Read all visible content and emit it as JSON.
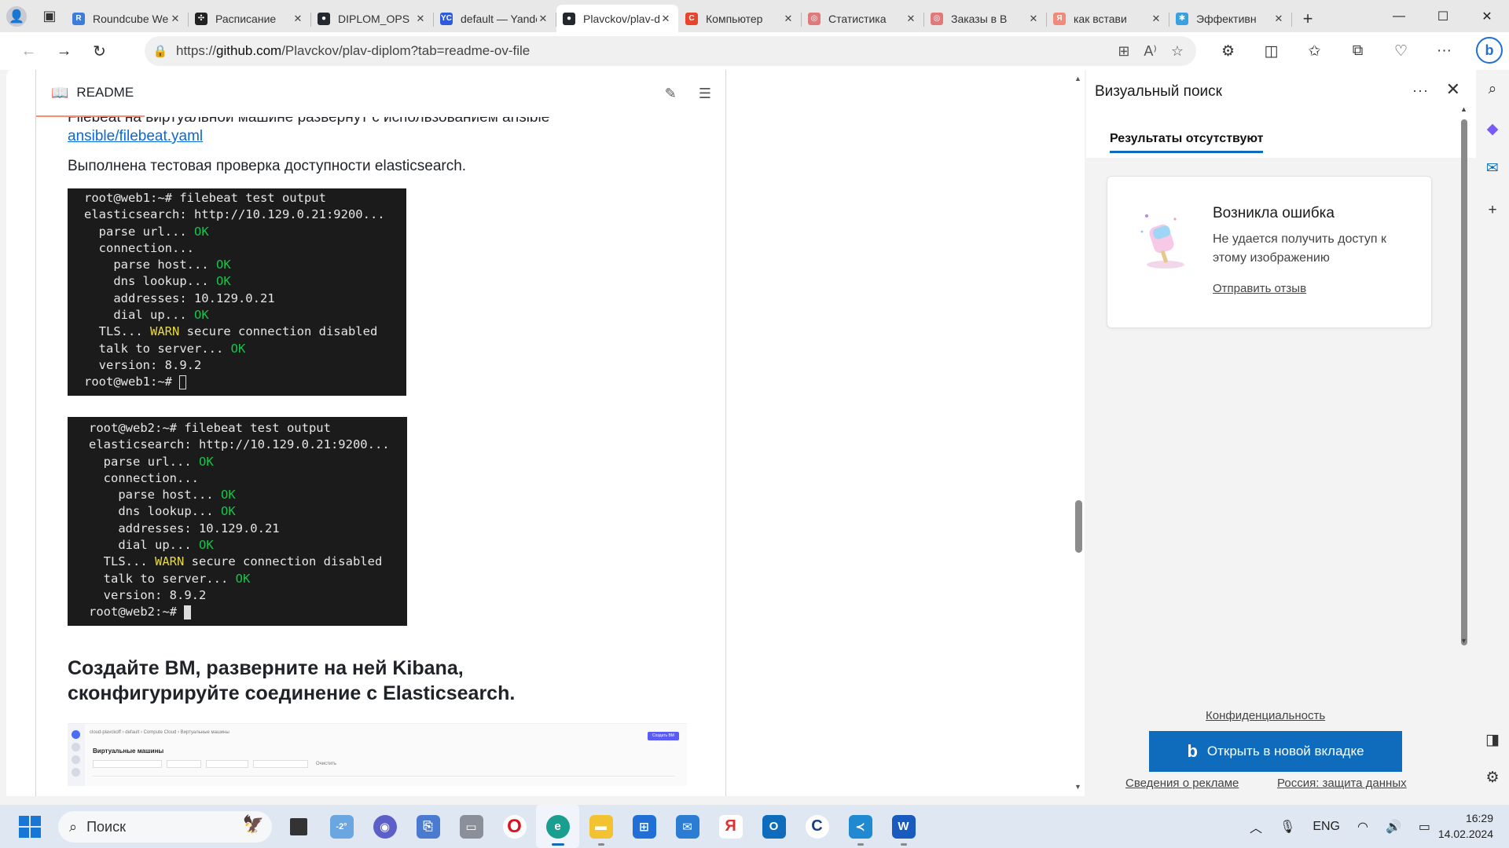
{
  "browser": {
    "tabs": [
      {
        "title": "Roundcube Webmail",
        "favicon_color": "#3b7dd8",
        "favicon_glyph": "R",
        "active": false
      },
      {
        "title": "Расписание",
        "favicon_color": "#222222",
        "favicon_glyph": "✣",
        "active": false
      },
      {
        "title": "DIPLOM_OPS",
        "favicon_color": "#24292f",
        "favicon_glyph": "●",
        "active": false
      },
      {
        "title": "default — Yandex",
        "favicon_color": "#2e5bd9",
        "favicon_glyph": "YC",
        "active": false
      },
      {
        "title": "Plavckov/plav-diplom",
        "favicon_color": "#24292f",
        "favicon_glyph": "●",
        "active": true
      },
      {
        "title": "Компьютер",
        "favicon_color": "#e8442d",
        "favicon_glyph": "C",
        "active": false
      },
      {
        "title": "Статистика",
        "favicon_color": "#e07a7a",
        "favicon_glyph": "◎",
        "active": false
      },
      {
        "title": "Заказы в В",
        "favicon_color": "#e07a7a",
        "favicon_glyph": "◎",
        "active": false
      },
      {
        "title": "как встави",
        "favicon_color": "#f08a7a",
        "favicon_glyph": "Я",
        "active": false
      },
      {
        "title": "Эффективн",
        "favicon_color": "#3aa0e0",
        "favicon_glyph": "✱",
        "active": false
      }
    ],
    "new_tab_glyph": "+",
    "window_controls": {
      "minimize": "—",
      "maximize": "☐",
      "close": "✕"
    },
    "address": {
      "url_prefix": "https://",
      "url_host": "github.com",
      "url_path": "/Plavckov/plav-diplom?tab=readme-ov-file"
    }
  },
  "readme": {
    "tab_label": "README",
    "cut_text": "Filebeat на виртуальной машине развернут с использованием ansible",
    "link_text": "ansible/filebeat.yaml",
    "check_text": "Выполнена тестовая проверка доступности elasticsearch.",
    "terminal1": {
      "prompt": "root@web1:~# filebeat test output",
      "es": "elasticsearch: http://10.129.0.21:9200...",
      "parse_url": "  parse url... ",
      "connection": "  connection...",
      "parse_host": "    parse host... ",
      "dns": "    dns lookup... ",
      "addresses": "    addresses: 10.129.0.21",
      "dial": "    dial up... ",
      "tls": "  TLS... ",
      "tls_rest": " secure connection disabled",
      "talk": "  talk to server... ",
      "version": "  version: 8.9.2",
      "end_prompt": "root@web1:~# ",
      "ok": "OK",
      "warn": "WARN"
    },
    "terminal2": {
      "prompt": "root@web2:~# filebeat test output",
      "es": "elasticsearch: http://10.129.0.21:9200...",
      "parse_url": "  parse url... ",
      "connection": "  connection...",
      "parse_host": "    parse host... ",
      "dns": "    dns lookup... ",
      "addresses": "    addresses: 10.129.0.21",
      "dial": "    dial up... ",
      "tls": "  TLS... ",
      "tls_rest": " secure connection disabled",
      "talk": "  talk to server... ",
      "version": "  version: 8.9.2",
      "end_prompt": "root@web2:~# ",
      "ok": "OK",
      "warn": "WARN"
    },
    "heading": "Создайте ВМ, разверните на ней Kibana, сконфигурируйте соединение с Elasticsearch.",
    "thumbnail": {
      "crumb": "cloud-plavckoff › default › Compute Cloud › Виртуальные машины",
      "title": "Виртуальные машины",
      "create_btn": "Создать ВМ",
      "clear": "Очистить"
    }
  },
  "visual_search": {
    "title": "Визуальный поиск",
    "more_glyph": "···",
    "tab_label": "Результаты отсутствуют",
    "error_title": "Возникла ошибка",
    "error_text": "Не удается получить доступ к этому изображению",
    "feedback": "Отправить отзыв",
    "privacy": "Конфиденциальность",
    "open_btn": "Открыть в новой вкладке",
    "ads": "Сведения о рекламе",
    "russia": "Россия: защита данных"
  },
  "taskbar": {
    "search_label": "Поиск",
    "weather": "-2°",
    "lang": "ENG",
    "time": "16:29",
    "date": "14.02.2024"
  },
  "colors": {
    "accent": "#0f6cbd",
    "github_link": "#0969da",
    "readme_tab_underline": "#fd8c73",
    "terminal_ok": "#19c24b",
    "terminal_warn": "#e6d84a"
  }
}
